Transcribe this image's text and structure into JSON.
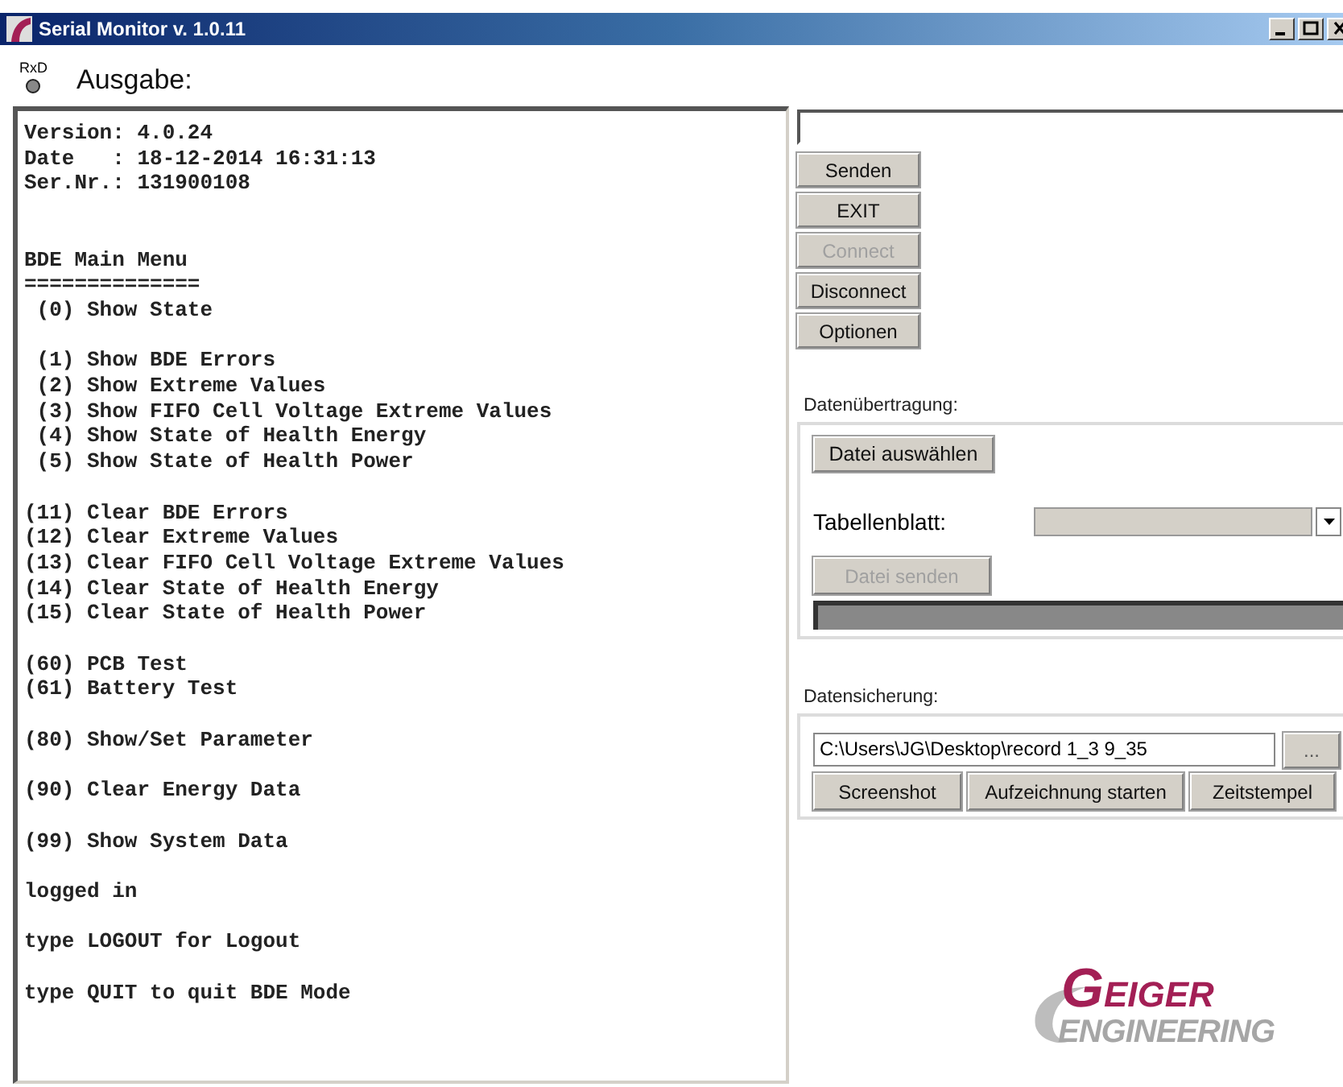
{
  "window": {
    "title": "Serial Monitor v. 1.0.11"
  },
  "header": {
    "rxd": {
      "label": "RxD",
      "on": false
    },
    "title": "Ausgabe:"
  },
  "console": {
    "groups": [
      [
        "Version: 4.0.24",
        "Date   : 18-12-2014 16:31:13",
        "Ser.Nr.: 131900108"
      ],
      [
        "BDE Main Menu",
        "==============",
        " (0) Show State"
      ],
      [
        " (1) Show BDE Errors",
        " (2) Show Extreme Values",
        " (3) Show FIFO Cell Voltage Extreme Values",
        " (4) Show State of Health Energy",
        " (5) Show State of Health Power"
      ],
      [
        "(11) Clear BDE Errors",
        "(12) Clear Extreme Values",
        "(13) Clear FIFO Cell Voltage Extreme Values",
        "(14) Clear State of Health Energy",
        "(15) Clear State of Health Power"
      ],
      [
        "(60) PCB Test",
        "(61) Battery Test"
      ],
      [
        "(80) Show/Set Parameter"
      ],
      [
        "(90) Clear Energy Data"
      ],
      [
        "(99) Show System Data"
      ],
      [
        "logged in"
      ],
      [
        "type LOGOUT for Logout"
      ],
      [
        "type QUIT to quit BDE Mode"
      ]
    ]
  },
  "command_buttons": [
    {
      "label": "Senden",
      "disabled": false
    },
    {
      "label": "EXIT",
      "disabled": false
    },
    {
      "label": "Connect",
      "disabled": true
    },
    {
      "label": "Disconnect",
      "disabled": false
    },
    {
      "label": "Optionen",
      "disabled": false
    }
  ],
  "data_transfer": {
    "title": "Datenübertragung:",
    "choose_button": "Datei auswählen",
    "sheet_label": "Tabellenblatt:",
    "send_button": {
      "label": "Datei senden",
      "disabled": true
    },
    "progress": {
      "level": 0
    }
  },
  "data_backup": {
    "title": "Datensicherung:",
    "path": "C:\\Users\\JG\\Desktop\\record 1_3 9_35",
    "browse_button": "...",
    "buttons": [
      "Screenshot",
      "Aufzeichnung starten",
      "Zeitstempel"
    ]
  },
  "logo": {
    "line_1": "GEIGER",
    "line_2": "ENGINEERING"
  }
}
